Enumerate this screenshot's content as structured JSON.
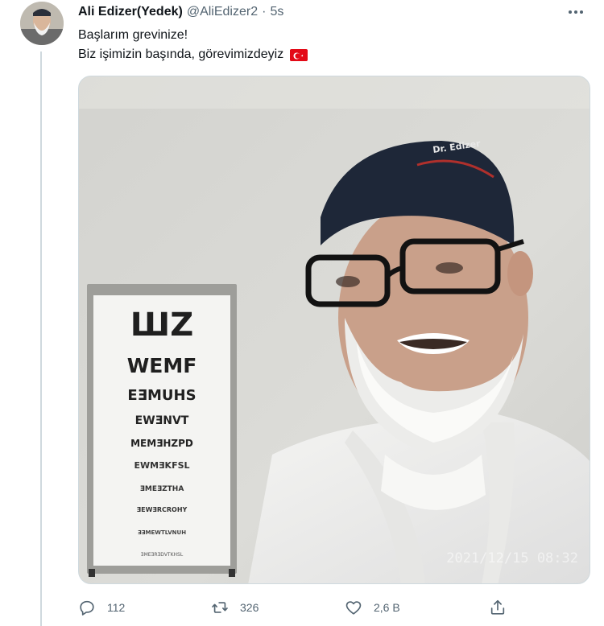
{
  "tweet": {
    "display_name": "Ali Edizer(Yedek)",
    "handle": "@AliEdizer2",
    "separator": "·",
    "time": "5s",
    "text_line1": "Başlarım grevinize!",
    "text_line2": "Biz işimizin başında, görevimizdeyiz",
    "flag_emoji": "turkey-flag"
  },
  "media": {
    "eye_chart_rows": [
      "ШZ",
      "WEMF",
      "EƎMUHS",
      "EWƎNVT",
      "MEMƎHZPD",
      "EWMƎKFSL",
      "ƎMEƎZTHA",
      "ƎEWƎRCROHY",
      "ƎƎMEWTLVNUH",
      "ƎMEƎRƎDVTKHSL"
    ],
    "cap_text": "Dr. Edizer",
    "timestamp": "2021/12/15 08:32"
  },
  "actions": {
    "reply_count": "112",
    "retweet_count": "326",
    "like_count": "2,6 B"
  },
  "colors": {
    "text_primary": "#0f1419",
    "text_secondary": "#536471",
    "border": "#cfd9de",
    "flag_red": "#e30a17"
  },
  "icons": [
    "more-icon",
    "reply-icon",
    "retweet-icon",
    "like-icon",
    "share-icon"
  ]
}
